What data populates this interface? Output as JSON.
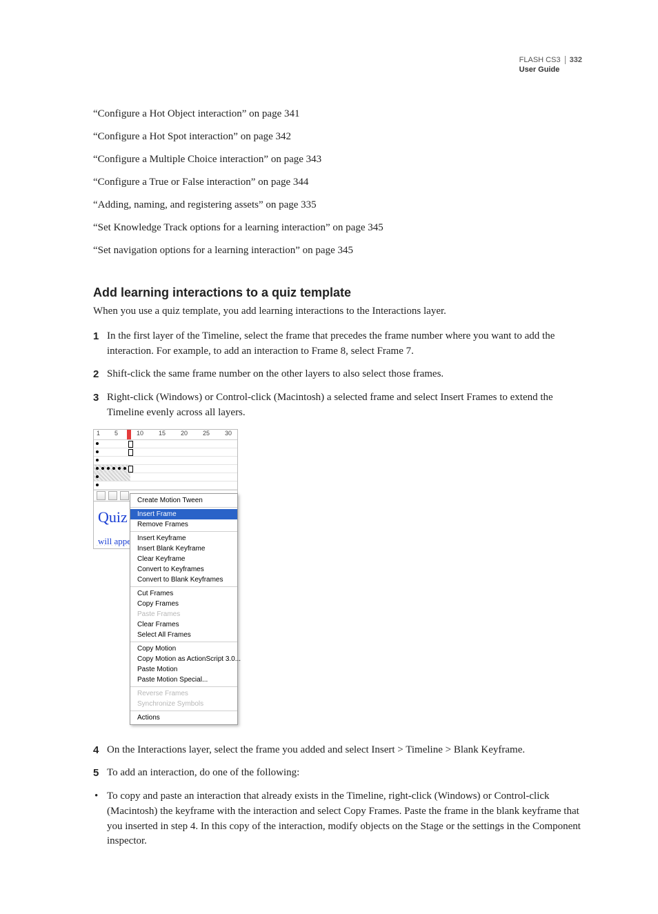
{
  "header": {
    "product": "FLASH CS3",
    "page_number": "332",
    "subtitle": "User Guide"
  },
  "xrefs": [
    "“Configure a Hot Object interaction” on page 341",
    "“Configure a Hot Spot interaction” on page 342",
    "“Configure a Multiple Choice interaction” on page 343",
    "“Configure a True or False interaction” on page 344",
    "“Adding, naming, and registering assets” on page 335",
    "“Set Knowledge Track options for a learning interaction” on page 345",
    "“Set navigation options for a learning interaction” on page 345"
  ],
  "section": {
    "heading": "Add learning interactions to a quiz template",
    "intro": "When you use a quiz template, you add learning interactions to the Interactions layer.",
    "steps_top": [
      {
        "n": "1",
        "t": "In the first layer of the Timeline, select the frame that precedes the frame number where you want to add the interaction. For example, to add an interaction to Frame 8, select Frame 7."
      },
      {
        "n": "2",
        "t": "Shift-click the same frame number on the other layers to also select those frames."
      },
      {
        "n": "3",
        "t": "Right-click (Windows) or Control-click (Macintosh) a selected frame and select Insert Frames to extend the Timeline evenly across all layers."
      }
    ],
    "steps_bottom": [
      {
        "n": "4",
        "t": "On the Interactions layer, select the frame you added and select Insert > Timeline > Blank Keyframe."
      },
      {
        "n": "5",
        "t": "To add an interaction, do one of the following:"
      }
    ],
    "bullet": "To copy and paste an interaction that already exists in the Timeline, right-click (Windows) or Control-click (Macintosh) the keyframe with the interaction and select Copy Frames. Paste the frame in the blank keyframe that you inserted in step 4. In this copy of the interaction, modify objects on the Stage or the settings in the Component inspector."
  },
  "figure": {
    "ruler_ticks": [
      "1",
      "5",
      "10",
      "15",
      "20",
      "25",
      "30"
    ],
    "stage_title": "Quiz",
    "stage_sub": "will appe",
    "stage_dots": ". . . . . . . . . . . .",
    "menu": {
      "g1": [
        "Create Motion Tween"
      ],
      "g2": [
        "Insert Frame",
        "Remove Frames"
      ],
      "g3": [
        "Insert Keyframe",
        "Insert Blank Keyframe",
        "Clear Keyframe",
        "Convert to Keyframes",
        "Convert to Blank Keyframes"
      ],
      "g4": [
        "Cut Frames",
        "Copy Frames",
        "Paste Frames",
        "Clear Frames",
        "Select All Frames"
      ],
      "g5": [
        "Copy Motion",
        "Copy Motion as ActionScript 3.0...",
        "Paste Motion",
        "Paste Motion Special..."
      ],
      "g6": [
        "Reverse Frames",
        "Synchronize Symbols"
      ],
      "g7": [
        "Actions"
      ]
    }
  }
}
